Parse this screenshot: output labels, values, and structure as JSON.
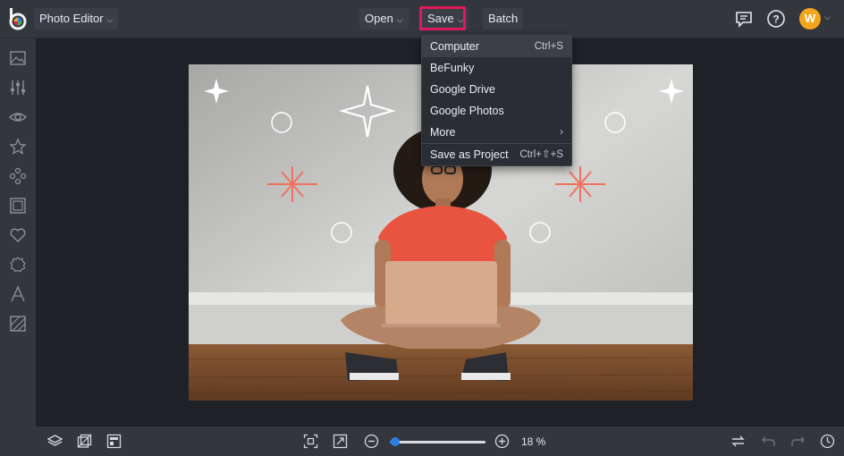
{
  "app": {
    "editor_label": "Photo Editor",
    "user_initial": "W"
  },
  "toolbar": {
    "open_label": "Open",
    "save_label": "Save",
    "batch_label": "Batch"
  },
  "save_menu": {
    "items": [
      {
        "label": "Computer",
        "shortcut": "Ctrl+S"
      },
      {
        "label": "BeFunky",
        "shortcut": ""
      },
      {
        "label": "Google Drive",
        "shortcut": ""
      },
      {
        "label": "Google Photos",
        "shortcut": ""
      },
      {
        "label": "More",
        "shortcut": "›"
      },
      {
        "label": "Save as Project",
        "shortcut": "Ctrl+⇧+S"
      }
    ]
  },
  "sidebar": {
    "icons": [
      "image-icon",
      "sliders-icon",
      "eye-icon",
      "star-icon",
      "nodes-icon",
      "frame-icon",
      "heart-icon",
      "badge-icon",
      "text-icon",
      "texture-icon"
    ]
  },
  "bottom": {
    "zoom_label": "18 %",
    "zoom_fraction": 0.18
  },
  "colors": {
    "accent": "#2e7de0",
    "highlight": "#e0195a",
    "avatar": "#f2a51d"
  }
}
